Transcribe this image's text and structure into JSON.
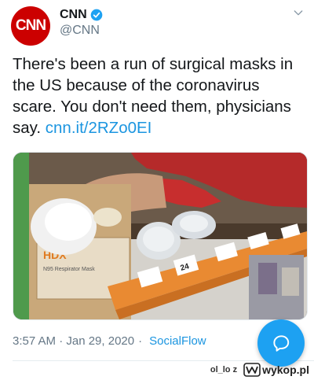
{
  "tweet": {
    "author": {
      "avatar_text": "CNN",
      "display_name": "CNN",
      "handle": "@CNN",
      "verified": true
    },
    "text": "There's been a run of surgical masks in the US because of the coronavirus scare. You don't need them, physicians say.",
    "link": "cnn.it/2RZo0EI",
    "media": {
      "box_brand": "HDX",
      "box_label": "N95 Respirator Mask",
      "price_tag": "24"
    },
    "timestamp": "3:57 AM · Jan 29, 2020",
    "separator": "·",
    "source": "SocialFlow"
  },
  "watermark": {
    "user": "ol_lo z",
    "brand": "wykop.pl"
  },
  "colors": {
    "accent": "#1da1f2",
    "link": "#1b95e0",
    "brand": "#cc0000"
  },
  "icons": {
    "verified": "verified-badge-icon",
    "menu": "chevron-down-icon",
    "compose": "compose-reply-icon"
  }
}
